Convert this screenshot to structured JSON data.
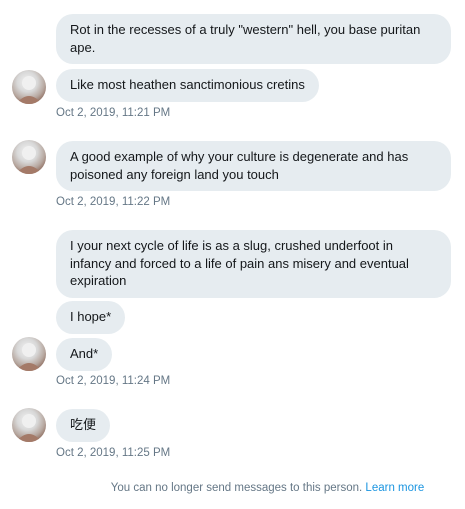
{
  "messages": [
    {
      "text": "Rot in the recesses of a truly \"western\" hell, you base puritan ape."
    },
    {
      "text": "Like most heathen sanctimonious cretins"
    },
    {
      "text": "A good example of why your culture is degenerate and has poisoned any foreign land you touch"
    },
    {
      "text": "I your next cycle of life is as a slug, crushed underfoot in infancy and forced to a life of pain ans misery and eventual expiration"
    },
    {
      "text": "I hope*"
    },
    {
      "text": "And*"
    },
    {
      "text": "吃便"
    }
  ],
  "timestamps": [
    "Oct 2, 2019, 11:21 PM",
    "Oct 2, 2019, 11:22 PM",
    "Oct 2, 2019, 11:24 PM",
    "Oct 2, 2019, 11:25 PM"
  ],
  "footer": {
    "notice": "You can no longer send messages to this person. ",
    "link": "Learn more"
  },
  "colors": {
    "bubble_bg": "#e6ecf0",
    "timestamp": "#657786",
    "link": "#1b95e0"
  },
  "icons": {
    "avatar": "user-avatar"
  }
}
